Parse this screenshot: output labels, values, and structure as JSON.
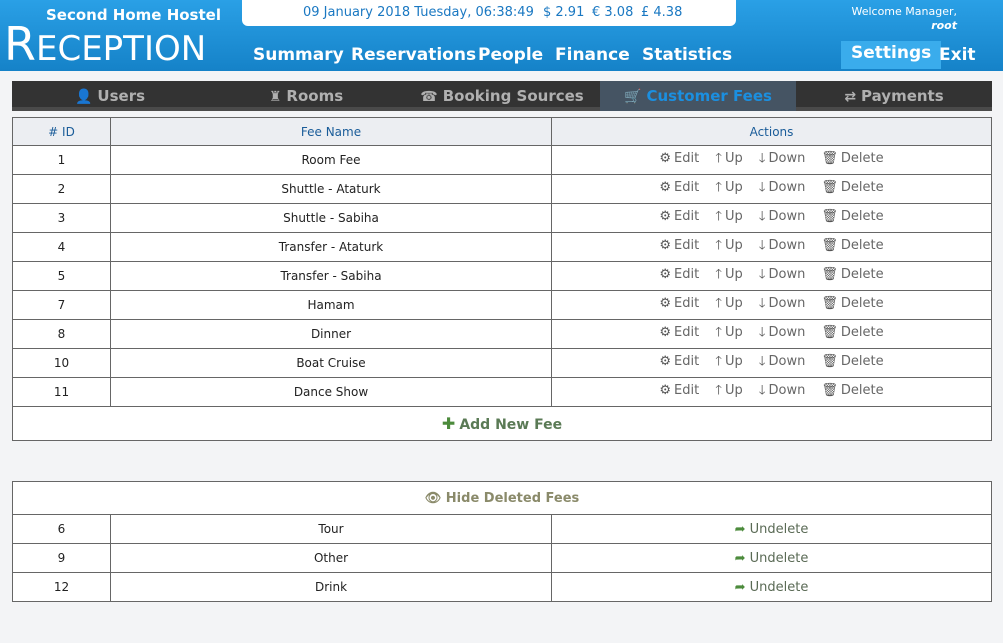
{
  "header": {
    "brand_top": "Second Home Hostel",
    "brand_R": "R",
    "brand_rest": "ECEPTION",
    "datetime": "09 January 2018 Tuesday, 06:38:49",
    "usd": "$ 2.91",
    "eur": "€ 3.08",
    "gbp": "£ 4.38",
    "welcome": "Welcome Manager,",
    "user": "root",
    "nav": [
      "Summary",
      "Reservations",
      "People",
      "Finance",
      "Statistics"
    ],
    "settings": "Settings",
    "exit": "Exit",
    "brand_color": "#1a8fd6"
  },
  "tabs": [
    {
      "label": "Users",
      "icon": "user-icon"
    },
    {
      "label": "Rooms",
      "icon": "rook-icon"
    },
    {
      "label": "Booking Sources",
      "icon": "phone-icon"
    },
    {
      "label": "Customer Fees",
      "icon": "cart-icon",
      "active": true
    },
    {
      "label": "Payments",
      "icon": "transfer-icon"
    }
  ],
  "fees_table": {
    "headers": [
      "# ID",
      "Fee Name",
      "Actions"
    ],
    "actions": {
      "edit": "Edit",
      "up": "Up",
      "down": "Down",
      "delete": "Delete"
    },
    "rows": [
      {
        "id": "1",
        "name": "Room Fee"
      },
      {
        "id": "2",
        "name": "Shuttle - Ataturk"
      },
      {
        "id": "3",
        "name": "Shuttle - Sabiha"
      },
      {
        "id": "4",
        "name": "Transfer - Ataturk"
      },
      {
        "id": "5",
        "name": "Transfer - Sabiha"
      },
      {
        "id": "7",
        "name": "Hamam"
      },
      {
        "id": "8",
        "name": "Dinner"
      },
      {
        "id": "10",
        "name": "Boat Cruise"
      },
      {
        "id": "11",
        "name": "Dance Show"
      }
    ],
    "add_label": "Add New Fee"
  },
  "deleted_table": {
    "toggle_label": "Hide Deleted Fees",
    "undelete_label": "Undelete",
    "rows": [
      {
        "id": "6",
        "name": "Tour"
      },
      {
        "id": "9",
        "name": "Other"
      },
      {
        "id": "12",
        "name": "Drink"
      }
    ]
  }
}
